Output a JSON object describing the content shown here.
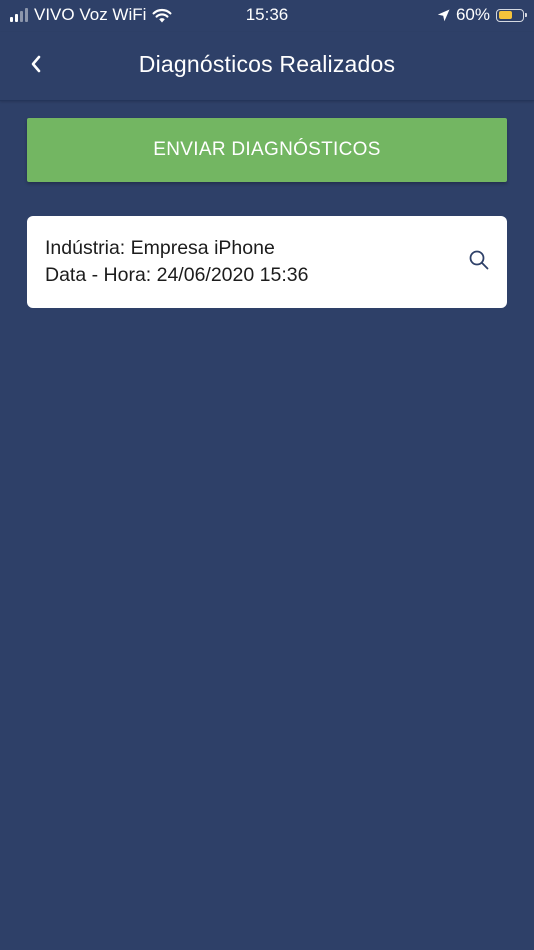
{
  "status_bar": {
    "carrier": "VIVO Voz WiFi",
    "time": "15:36",
    "battery_percent": "60%",
    "battery_level": 0.6,
    "battery_color": "#f5c33b"
  },
  "header": {
    "title": "Diagnósticos Realizados",
    "back_icon": "chevron-left-icon"
  },
  "actions": {
    "send_label": "ENVIAR DIAGNÓSTICOS",
    "send_color": "#73b662"
  },
  "diagnostics": [
    {
      "industry_line": "Indústria: Empresa iPhone",
      "datetime_line": "Data - Hora: 24/06/2020 15:36",
      "icon": "search-icon"
    }
  ],
  "colors": {
    "background": "#2e4068",
    "card": "#ffffff",
    "icon_accent": "#2e4068"
  }
}
